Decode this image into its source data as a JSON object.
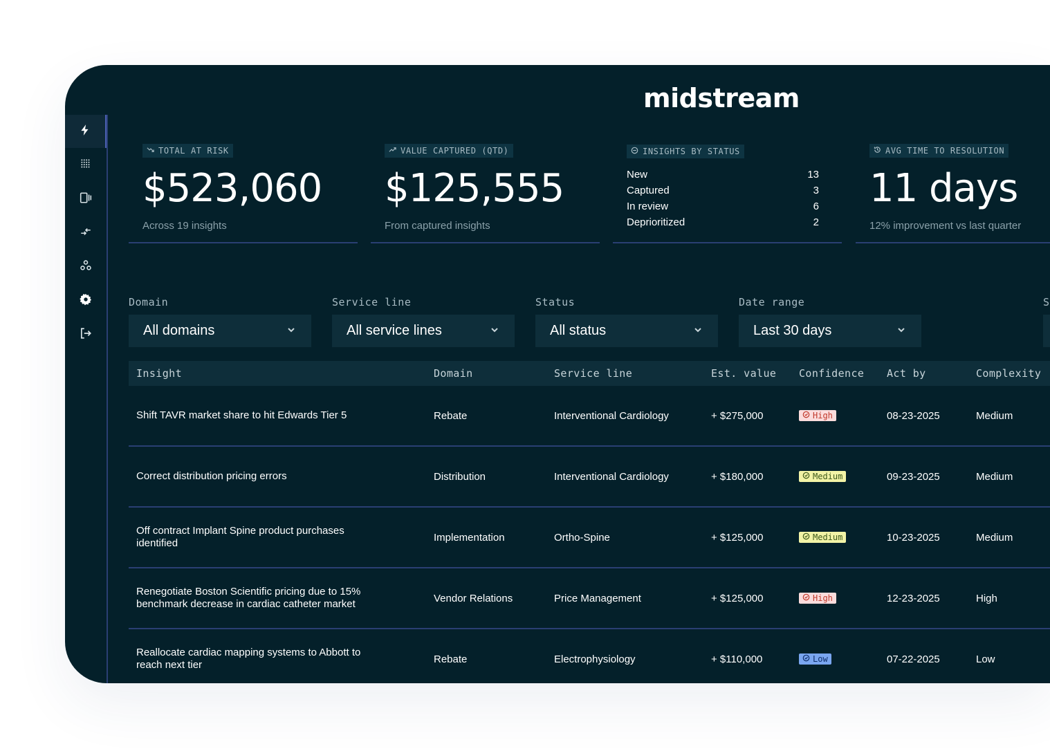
{
  "app": {
    "logo": "midstream"
  },
  "sidebar": {
    "items": [
      {
        "icon": "bolt-icon",
        "active": true
      },
      {
        "icon": "grid-dots-icon"
      },
      {
        "icon": "device-panels-icon"
      },
      {
        "icon": "arrows-exchange-icon"
      },
      {
        "icon": "people-group-icon"
      },
      {
        "icon": "gear-icon"
      },
      {
        "icon": "logout-icon"
      }
    ]
  },
  "kpis": {
    "total_at_risk": {
      "tag": "TOTAL AT RISK",
      "value": "$523,060",
      "sub": "Across 19 insights",
      "icon": "trend-down-icon"
    },
    "value_captured": {
      "tag": "VALUE CAPTURED (QTD)",
      "value": "$125,555",
      "sub": "From captured insights",
      "icon": "trend-up-icon"
    },
    "insights_by_status": {
      "tag": "INSIGHTS BY STATUS",
      "icon": "circle-minus-icon",
      "rows": [
        {
          "label": "New",
          "count": "13"
        },
        {
          "label": "Captured",
          "count": "3"
        },
        {
          "label": "In review",
          "count": "6"
        },
        {
          "label": "Deprioritized",
          "count": "2"
        }
      ]
    },
    "avg_time": {
      "tag": "AVG TIME TO RESOLUTION",
      "value": "11 days",
      "sub": "12% improvement vs last quarter",
      "icon": "history-icon"
    }
  },
  "filters": [
    {
      "label": "Domain",
      "value": "All domains"
    },
    {
      "label": "Service line",
      "value": "All service lines"
    },
    {
      "label": "Status",
      "value": "All status"
    },
    {
      "label": "Date range",
      "value": "Last 30 days"
    },
    {
      "label": "S",
      "value": ""
    }
  ],
  "table": {
    "headers": [
      "Insight",
      "Domain",
      "Service line",
      "Est. value",
      "Confidence",
      "Act by",
      "Complexity"
    ],
    "rows": [
      {
        "insight": "Shift TAVR market share to hit Edwards Tier 5",
        "domain": "Rebate",
        "service_line": "Interventional Cardiology",
        "value": "+ $275,000",
        "confidence": "High",
        "act_by": "08-23-2025",
        "complexity": "Medium"
      },
      {
        "insight": "Correct distribution pricing errors",
        "domain": "Distribution",
        "service_line": "Interventional Cardiology",
        "value": "+ $180,000",
        "confidence": "Medium",
        "act_by": "09-23-2025",
        "complexity": "Medium"
      },
      {
        "insight": "Off contract Implant Spine product purchases identified",
        "domain": "Implementation",
        "service_line": "Ortho-Spine",
        "value": "+ $125,000",
        "confidence": "Medium",
        "act_by": "10-23-2025",
        "complexity": "Medium"
      },
      {
        "insight": "Renegotiate Boston Scientific pricing due to 15% benchmark decrease in cardiac catheter market",
        "domain": "Vendor Relations",
        "service_line": "Price Management",
        "value": "+ $125,000",
        "confidence": "High",
        "act_by": "12-23-2025",
        "complexity": "High"
      },
      {
        "insight": "Reallocate cardiac mapping systems to Abbott to reach next tier",
        "domain": "Rebate",
        "service_line": "Electrophysiology",
        "value": "+ $110,000",
        "confidence": "Low",
        "act_by": "07-22-2025",
        "complexity": "Low"
      }
    ]
  }
}
